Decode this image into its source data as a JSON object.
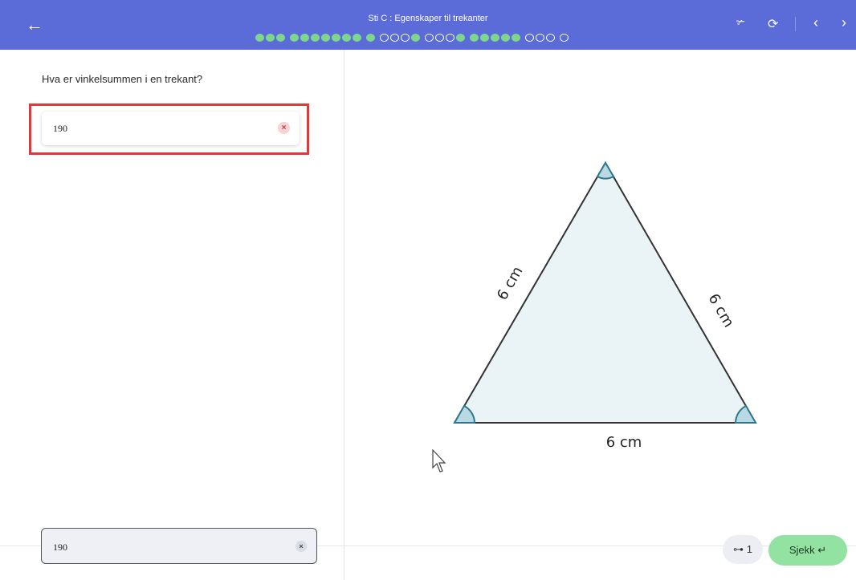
{
  "header": {
    "title": "Sti C : Egenskaper til trekanter",
    "back_icon": "arrow-left-icon",
    "progress_dots": [
      "f",
      "f",
      "f",
      "sep",
      "f",
      "f",
      "f",
      "f",
      "f",
      "f",
      "f",
      "sep",
      "f",
      "sep",
      "e",
      "e",
      "e",
      "f",
      "sep",
      "e",
      "e",
      "e",
      "f",
      "sep",
      "f",
      "f",
      "f",
      "f",
      "f",
      "sep",
      "c",
      "e",
      "e",
      "sep",
      "e"
    ],
    "right_icons": [
      "podium-icon",
      "refresh-icon",
      "chevron-left-icon",
      "chevron-right-icon"
    ]
  },
  "question": {
    "text": "Hva er vinkelsummen i en trekant?",
    "answer": "190"
  },
  "figure": {
    "side_left": "6 cm",
    "side_right": "6 cm",
    "side_bottom": "6 cm",
    "fill": "#eaf4f6",
    "angle_color": "#2d7890"
  },
  "footer": {
    "input_value": "190",
    "hint_count": "1",
    "check_label": "Sjekk",
    "accent": "#92e3a1"
  }
}
